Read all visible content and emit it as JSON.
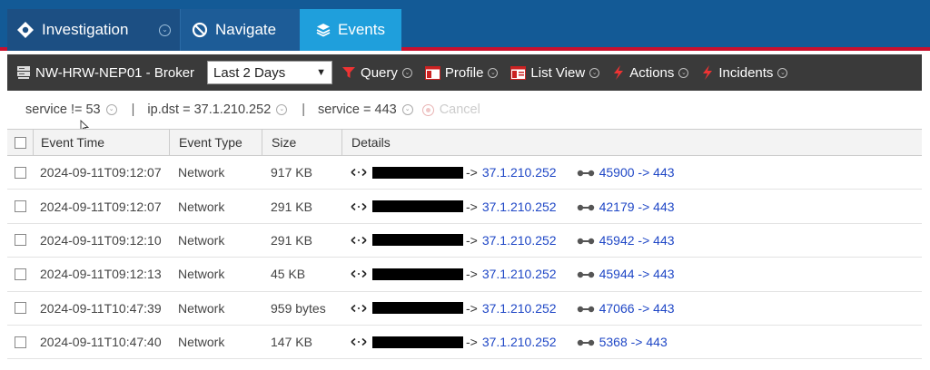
{
  "tabs": [
    {
      "label": "Investigation",
      "icon": "investigation-icon"
    },
    {
      "label": "Navigate",
      "icon": "navigate-icon"
    },
    {
      "label": "Events",
      "icon": "events-icon"
    }
  ],
  "toolbar": {
    "device": "NW-HRW-NEP01 - Broker",
    "time_range": "Last 2 Days",
    "query": "Query",
    "profile": "Profile",
    "list_view": "List View",
    "actions": "Actions",
    "incidents": "Incidents"
  },
  "filters": {
    "items": [
      "service != 53",
      "ip.dst = 37.1.210.252",
      "service = 443"
    ],
    "cancel": "Cancel"
  },
  "columns": [
    "Event Time",
    "Event Type",
    "Size",
    "Details"
  ],
  "rows": [
    {
      "time": "2024-09-11T09:12:07",
      "type": "Network",
      "size": "917 KB",
      "dst": "37.1.210.252",
      "src_port": "45900",
      "dst_port": "443"
    },
    {
      "time": "2024-09-11T09:12:07",
      "type": "Network",
      "size": "291 KB",
      "dst": "37.1.210.252",
      "src_port": "42179",
      "dst_port": "443"
    },
    {
      "time": "2024-09-11T09:12:10",
      "type": "Network",
      "size": "291 KB",
      "dst": "37.1.210.252",
      "src_port": "45942",
      "dst_port": "443"
    },
    {
      "time": "2024-09-11T09:12:13",
      "type": "Network",
      "size": "45 KB",
      "dst": "37.1.210.252",
      "src_port": "45944",
      "dst_port": "443"
    },
    {
      "time": "2024-09-11T10:47:39",
      "type": "Network",
      "size": "959 bytes",
      "dst": "37.1.210.252",
      "src_port": "47066",
      "dst_port": "443"
    },
    {
      "time": "2024-09-11T10:47:40",
      "type": "Network",
      "size": "147 KB",
      "dst": "37.1.210.252",
      "src_port": "5368",
      "dst_port": "443"
    }
  ],
  "symbols": {
    "arrow": "->"
  }
}
